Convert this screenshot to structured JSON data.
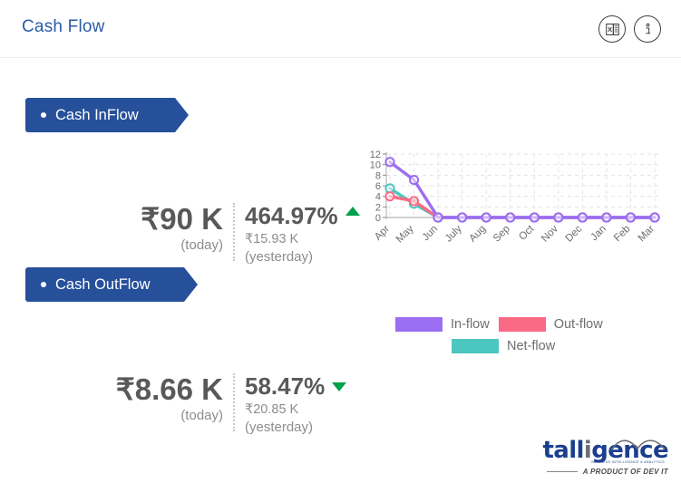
{
  "header": {
    "title": "Cash Flow",
    "actions": [
      {
        "name": "excel-export-icon",
        "label": "Export to Excel"
      },
      {
        "name": "info-icon",
        "label": "Information"
      }
    ]
  },
  "sections": [
    {
      "ribbon_label": "Cash InFlow",
      "value": "₹90 K",
      "value_period": "(today)",
      "percent": "464.97%",
      "trend": "up",
      "trend_color": "#00a14b",
      "previous_value": "₹15.93 K",
      "previous_period": "(yesterday)"
    },
    {
      "ribbon_label": "Cash OutFlow",
      "value": "₹8.66 K",
      "value_period": "(today)",
      "percent": "58.47%",
      "trend": "down",
      "trend_color": "#00a14b",
      "previous_value": "₹20.85 K",
      "previous_period": "(yesterday)"
    }
  ],
  "legend": [
    {
      "label": "In-flow",
      "color": "#9b6ef3"
    },
    {
      "label": "Out-flow",
      "color": "#fb6a84"
    },
    {
      "label": "Net-flow",
      "color": "#4cc6c0"
    }
  ],
  "logo": {
    "word_part1": "tall",
    "word_part2": "i",
    "word_part3": "gence",
    "tagline": "BUSINESS INTELLIGENCE & ANALYTICS",
    "subtitle": "A PRODUCT OF DEV IT"
  },
  "chart_data": {
    "type": "line",
    "title": "",
    "xlabel": "",
    "ylabel": "",
    "categories": [
      "Apr",
      "May",
      "Jun",
      "July",
      "Aug",
      "Sep",
      "Oct",
      "Nov",
      "Dec",
      "Jan",
      "Feb",
      "Mar"
    ],
    "yticks": [
      12,
      10,
      8,
      6,
      4,
      2,
      0
    ],
    "ylim": [
      0,
      12
    ],
    "grid": true,
    "grid_style": "dashed",
    "legend_position": "bottom",
    "series": [
      {
        "name": "In-flow",
        "color": "#9b6ef3",
        "values": [
          10.5,
          7.1,
          0,
          0,
          0,
          0,
          0,
          0,
          0,
          0,
          0,
          0
        ]
      },
      {
        "name": "Out-flow",
        "color": "#fb6a84",
        "values": [
          4.0,
          3.1,
          0,
          0,
          0,
          0,
          0,
          0,
          0,
          0,
          0,
          0
        ]
      },
      {
        "name": "Net-flow",
        "color": "#4cc6c0",
        "values": [
          5.5,
          2.6,
          0,
          0,
          0,
          0,
          0,
          0,
          0,
          0,
          0,
          0
        ]
      }
    ]
  }
}
